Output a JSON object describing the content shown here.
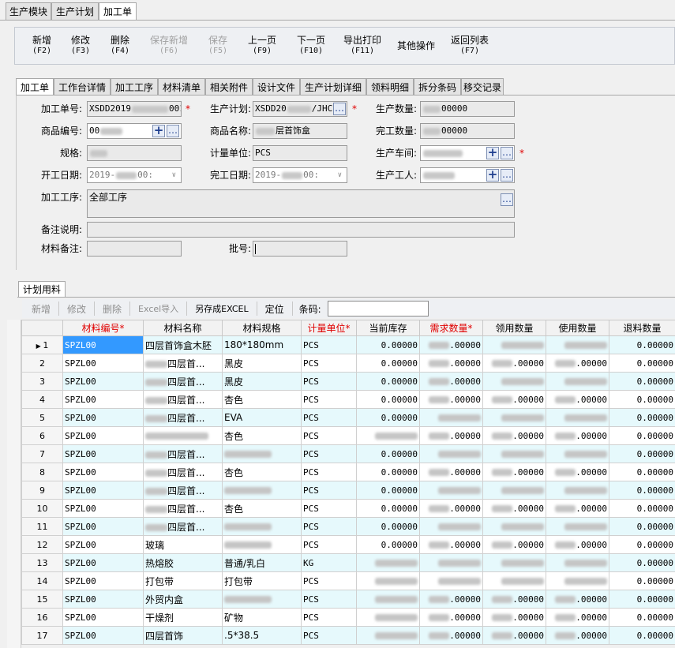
{
  "top_tabs": [
    "生产模块",
    "生产计划",
    "加工单"
  ],
  "toolbar": [
    {
      "label": "新增",
      "key": "(F2)",
      "enabled": true
    },
    {
      "label": "修改",
      "key": "(F3)",
      "enabled": true
    },
    {
      "label": "删除",
      "key": "(F4)",
      "enabled": true
    },
    {
      "label": "保存新增",
      "key": "(F6)",
      "enabled": false
    },
    {
      "label": "保存",
      "key": "(F5)",
      "enabled": false
    },
    {
      "label": "上一页",
      "key": "(F9)",
      "enabled": true
    },
    {
      "label": "下一页",
      "key": "(F10)",
      "enabled": true
    },
    {
      "label": "导出打印",
      "key": "(F11)",
      "enabled": true
    },
    {
      "label": "其他操作",
      "key": "",
      "enabled": true
    },
    {
      "label": "返回列表",
      "key": "(F7)",
      "enabled": true
    }
  ],
  "sub_tabs": [
    "加工单",
    "工作台详情",
    "加工工序",
    "材料清单",
    "相关附件",
    "设计文件",
    "生产计划详细",
    "领料明细",
    "拆分条码",
    "移交记录"
  ],
  "form": {
    "order_no": {
      "label": "加工单号:",
      "prefix": "XSDD2019",
      "suffix": "0012"
    },
    "plan": {
      "label": "生产计划:",
      "prefix": "XSDD20",
      "suffix": "/JHC"
    },
    "qty": {
      "label": "生产数量:",
      "value": "00000"
    },
    "goods_no": {
      "label": "商品编号:",
      "prefix": "00"
    },
    "goods_name": {
      "label": "商品名称:",
      "suffix": "层首饰盒"
    },
    "done_qty": {
      "label": "完工数量:",
      "value": "00000"
    },
    "spec": {
      "label": "规格:"
    },
    "unit": {
      "label": "计量单位:",
      "value": "PCS"
    },
    "workshop": {
      "label": "生产车间:"
    },
    "start_date": {
      "label": "开工日期:",
      "prefix": "2019-",
      "suffix": "00:"
    },
    "end_date": {
      "label": "完工日期:",
      "prefix": "2019-",
      "suffix": "00:"
    },
    "worker": {
      "label": "生产工人:"
    },
    "process": {
      "label": "加工工序:",
      "value": "全部工序"
    },
    "remark": {
      "label": "备注说明:"
    },
    "material_remark": {
      "label": "材料备注:"
    },
    "batch": {
      "label": "批号:"
    }
  },
  "grid_panel": {
    "tab": "计划用料",
    "buttons": [
      {
        "label": "新增",
        "enabled": false
      },
      {
        "label": "修改",
        "enabled": false
      },
      {
        "label": "删除",
        "enabled": false
      },
      {
        "label": "Excel导入",
        "enabled": false
      },
      {
        "label": "另存成EXCEL",
        "enabled": true
      },
      {
        "label": "定位",
        "enabled": true
      }
    ],
    "barcode_label": "条码:"
  },
  "columns": [
    {
      "label": "",
      "required": false
    },
    {
      "label": "材料编号*",
      "required": true
    },
    {
      "label": "材料名称",
      "required": false
    },
    {
      "label": "材料规格",
      "required": false
    },
    {
      "label": "计量单位*",
      "required": true
    },
    {
      "label": "当前库存",
      "required": false
    },
    {
      "label": "需求数量*",
      "required": true
    },
    {
      "label": "领用数量",
      "required": false
    },
    {
      "label": "使用数量",
      "required": false
    },
    {
      "label": "退料数量",
      "required": false
    }
  ],
  "rows": [
    {
      "n": "1",
      "code": "SPZL00",
      "name": "四层首饰盒木胚",
      "spec": "180*180mm",
      "unit": "PCS",
      "stock": "0.00000",
      "need": ".00000",
      "used": "",
      "consumed": "",
      "ret": "0.00000"
    },
    {
      "n": "2",
      "code": "SPZL00",
      "name": "四层首...",
      "spec": "黑皮",
      "unit": "PCS",
      "stock": "0.00000",
      "need": ".00000",
      "used": ".00000",
      "consumed": ".00000",
      "ret": "0.00000"
    },
    {
      "n": "3",
      "code": "SPZL00",
      "name": "四层首...",
      "spec": "黑皮",
      "unit": "PCS",
      "stock": "0.00000",
      "need": ".00000",
      "used": "",
      "consumed": "",
      "ret": "0.00000"
    },
    {
      "n": "4",
      "code": "SPZL00",
      "name": "四层首...",
      "spec": "杏色",
      "unit": "PCS",
      "stock": "0.00000",
      "need": ".00000",
      "used": ".00000",
      "consumed": ".00000",
      "ret": "0.00000"
    },
    {
      "n": "5",
      "code": "SPZL00",
      "name": "四层首...",
      "spec": "EVA",
      "unit": "PCS",
      "stock": "0.00000",
      "need": "",
      "used": "",
      "consumed": "",
      "ret": "0.00000"
    },
    {
      "n": "6",
      "code": "SPZL00",
      "name": "",
      "spec": "杏色",
      "unit": "PCS",
      "stock": "",
      "need": ".00000",
      "used": ".00000",
      "consumed": ".00000",
      "ret": "0.00000"
    },
    {
      "n": "7",
      "code": "SPZL00",
      "name": "四层首...",
      "spec": "",
      "unit": "PCS",
      "stock": "0.00000",
      "need": "",
      "used": "",
      "consumed": "",
      "ret": "0.00000"
    },
    {
      "n": "8",
      "code": "SPZL00",
      "name": "四层首...",
      "spec": "杏色",
      "unit": "PCS",
      "stock": "0.00000",
      "need": ".00000",
      "used": ".00000",
      "consumed": ".00000",
      "ret": "0.00000"
    },
    {
      "n": "9",
      "code": "SPZL00",
      "name": "四层首...",
      "spec": "",
      "unit": "PCS",
      "stock": "0.00000",
      "need": "",
      "used": "",
      "consumed": "",
      "ret": "0.00000"
    },
    {
      "n": "10",
      "code": "SPZL00",
      "name": "四层首...",
      "spec": "杏色",
      "unit": "PCS",
      "stock": "0.00000",
      "need": ".00000",
      "used": ".00000",
      "consumed": ".00000",
      "ret": "0.00000"
    },
    {
      "n": "11",
      "code": "SPZL00",
      "name": "四层首...",
      "spec": "",
      "unit": "PCS",
      "stock": "0.00000",
      "need": "",
      "used": "",
      "consumed": "",
      "ret": "0.00000"
    },
    {
      "n": "12",
      "code": "SPZL00",
      "name": "玻璃",
      "spec": "",
      "unit": "PCS",
      "stock": "0.00000",
      "need": ".00000",
      "used": ".00000",
      "consumed": ".00000",
      "ret": "0.00000"
    },
    {
      "n": "13",
      "code": "SPZL00",
      "name": "热熔胶",
      "spec": "普通/乳白",
      "unit": "KG",
      "stock": "",
      "need": "",
      "used": "",
      "consumed": "",
      "ret": "0.00000"
    },
    {
      "n": "14",
      "code": "SPZL00",
      "name": "打包带",
      "spec": "打包带",
      "unit": "PCS",
      "stock": "",
      "need": "",
      "used": "",
      "consumed": "",
      "ret": "0.00000"
    },
    {
      "n": "15",
      "code": "SPZL00",
      "name": "外贸内盒",
      "spec": "",
      "unit": "PCS",
      "stock": "",
      "need": ".00000",
      "used": ".00000",
      "consumed": ".00000",
      "ret": "0.00000"
    },
    {
      "n": "16",
      "code": "SPZL00",
      "name": "干燥剂",
      "spec": "矿物",
      "unit": "PCS",
      "stock": "",
      "need": ".00000",
      "used": ".00000",
      "consumed": ".00000",
      "ret": "0.00000"
    },
    {
      "n": "17",
      "code": "SPZL00",
      "name": "四层首饰",
      "spec": ".5*38.5",
      "unit": "PCS",
      "stock": "",
      "need": ".00000",
      "used": ".00000",
      "consumed": ".00000",
      "ret": "0.00000"
    }
  ]
}
